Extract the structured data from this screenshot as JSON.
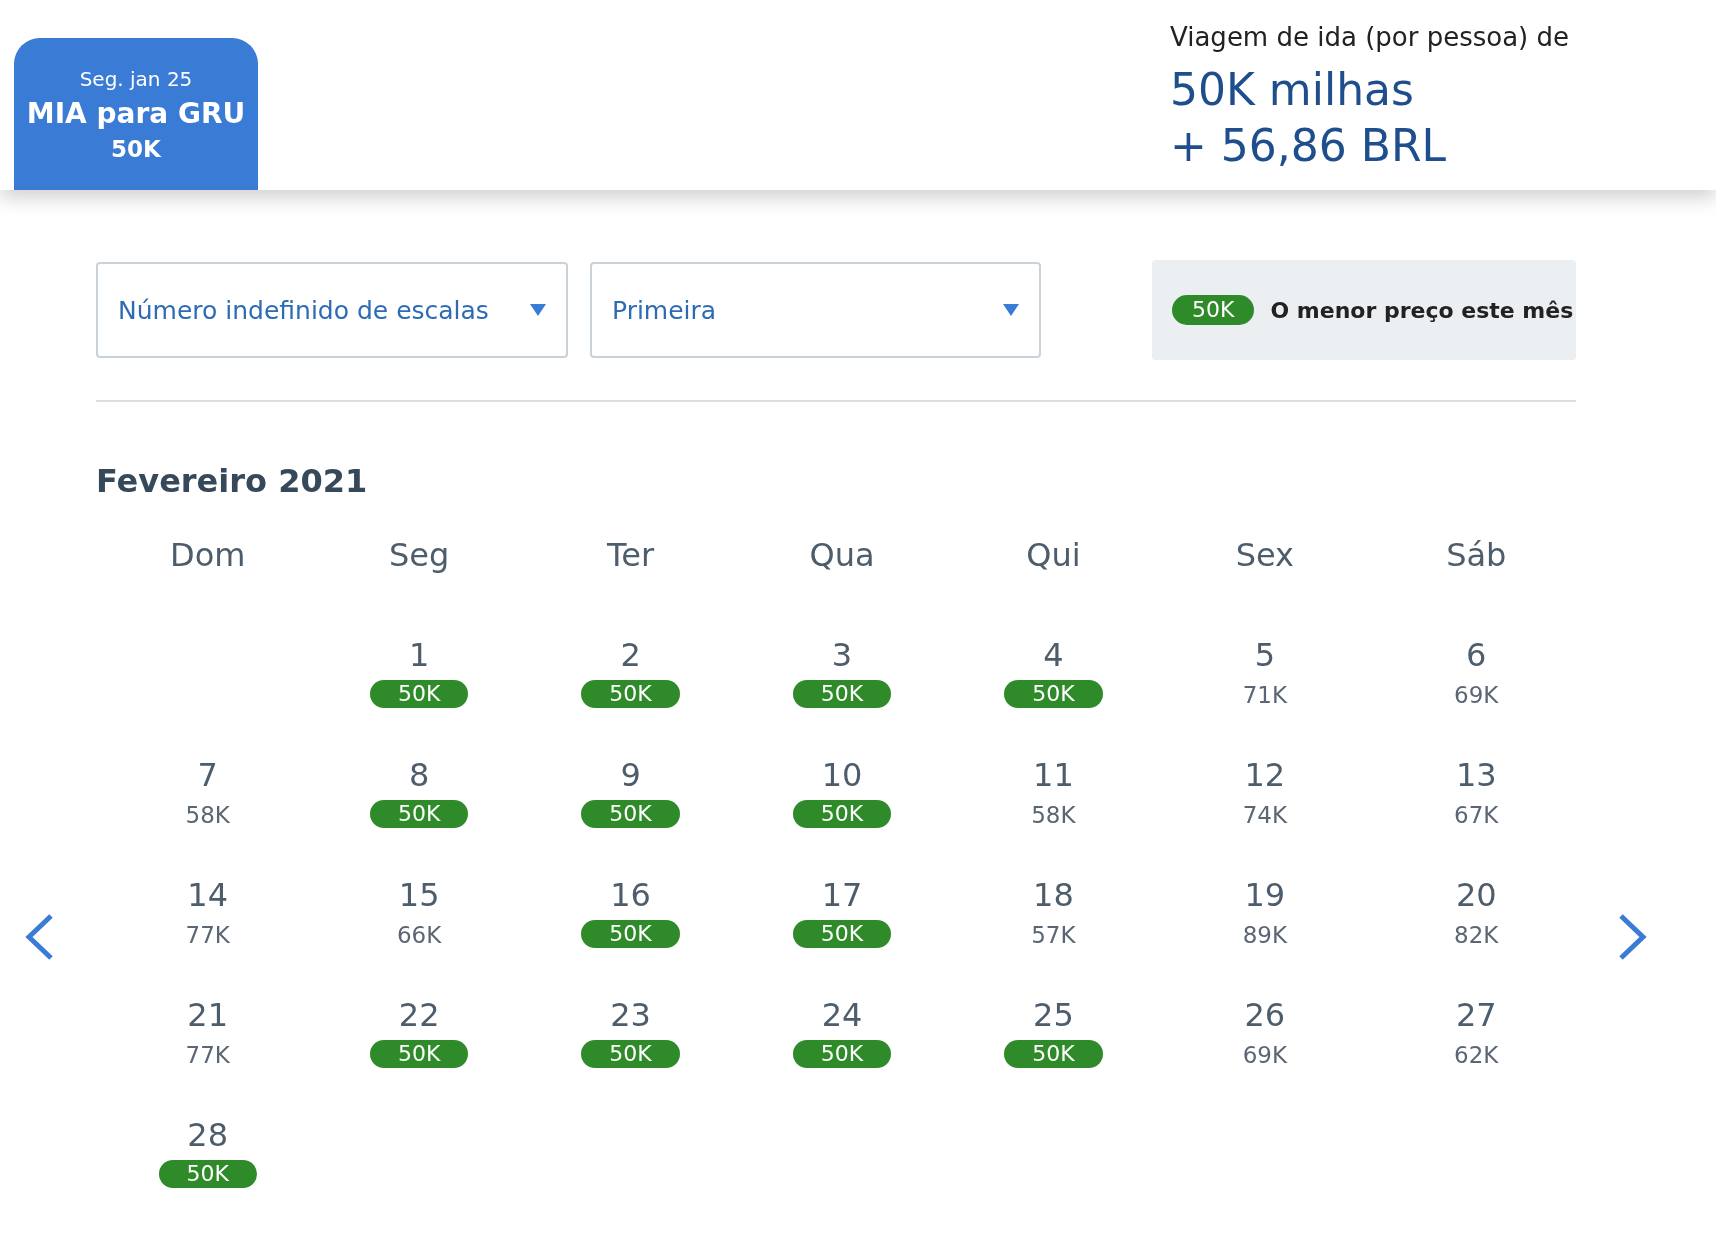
{
  "trip_tab": {
    "date": "Seg. jan 25",
    "route": "MIA para GRU",
    "price": "50K",
    "selected": true
  },
  "fare_summary": {
    "label": "Viagem de ida (por pessoa) de",
    "miles": "50K milhas",
    "cash": "+ 56,86 BRL"
  },
  "filters": [
    {
      "value": "Número indefinido de escalas"
    },
    {
      "value": "Primeira"
    }
  ],
  "legend": {
    "badge": "50K",
    "text": "O menor preço este mês"
  },
  "calendar": {
    "month": "Fevereiro 2021",
    "weekdays": [
      "Dom",
      "Seg",
      "Ter",
      "Qua",
      "Qui",
      "Sex",
      "Sáb"
    ],
    "weeks": [
      [
        {
          "kind": "blank"
        },
        {
          "kind": "day",
          "day": "1",
          "price": "50K",
          "lowest": true
        },
        {
          "kind": "day",
          "day": "2",
          "price": "50K",
          "lowest": true
        },
        {
          "kind": "day",
          "day": "3",
          "price": "50K",
          "lowest": true
        },
        {
          "kind": "day",
          "day": "4",
          "price": "50K",
          "lowest": true
        },
        {
          "kind": "day",
          "day": "5",
          "price": "71K",
          "lowest": false
        },
        {
          "kind": "day",
          "day": "6",
          "price": "69K",
          "lowest": false
        }
      ],
      [
        {
          "kind": "day",
          "day": "7",
          "price": "58K",
          "lowest": false
        },
        {
          "kind": "day",
          "day": "8",
          "price": "50K",
          "lowest": true
        },
        {
          "kind": "day",
          "day": "9",
          "price": "50K",
          "lowest": true
        },
        {
          "kind": "day",
          "day": "10",
          "price": "50K",
          "lowest": true
        },
        {
          "kind": "day",
          "day": "11",
          "price": "58K",
          "lowest": false
        },
        {
          "kind": "day",
          "day": "12",
          "price": "74K",
          "lowest": false
        },
        {
          "kind": "day",
          "day": "13",
          "price": "67K",
          "lowest": false
        }
      ],
      [
        {
          "kind": "day",
          "day": "14",
          "price": "77K",
          "lowest": false
        },
        {
          "kind": "day",
          "day": "15",
          "price": "66K",
          "lowest": false
        },
        {
          "kind": "day",
          "day": "16",
          "price": "50K",
          "lowest": true
        },
        {
          "kind": "day",
          "day": "17",
          "price": "50K",
          "lowest": true
        },
        {
          "kind": "day",
          "day": "18",
          "price": "57K",
          "lowest": false
        },
        {
          "kind": "day",
          "day": "19",
          "price": "89K",
          "lowest": false
        },
        {
          "kind": "day",
          "day": "20",
          "price": "82K",
          "lowest": false
        }
      ],
      [
        {
          "kind": "day",
          "day": "21",
          "price": "77K",
          "lowest": false
        },
        {
          "kind": "day",
          "day": "22",
          "price": "50K",
          "lowest": true
        },
        {
          "kind": "day",
          "day": "23",
          "price": "50K",
          "lowest": true
        },
        {
          "kind": "day",
          "day": "24",
          "price": "50K",
          "lowest": true
        },
        {
          "kind": "day",
          "day": "25",
          "price": "50K",
          "lowest": true
        },
        {
          "kind": "day",
          "day": "26",
          "price": "69K",
          "lowest": false
        },
        {
          "kind": "day",
          "day": "27",
          "price": "62K",
          "lowest": false
        }
      ],
      [
        {
          "kind": "day",
          "day": "28",
          "price": "50K",
          "lowest": true
        }
      ]
    ]
  }
}
